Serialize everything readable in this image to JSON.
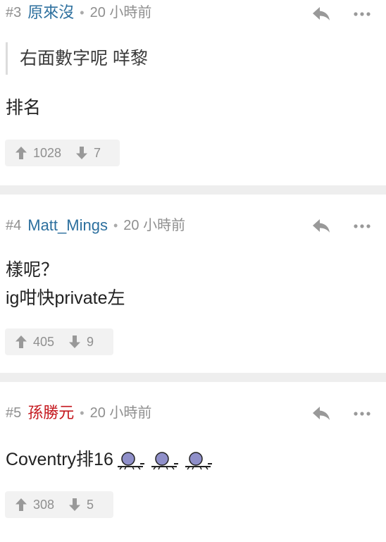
{
  "posts": [
    {
      "number": "#3",
      "username": "原來沒",
      "gender": "male",
      "time": "20 小時前",
      "quote": "右面數字呢 咩黎",
      "body_lines": [
        "排名"
      ],
      "upvotes": "1028",
      "downvotes": "7"
    },
    {
      "number": "#4",
      "username": "Matt_Mings",
      "gender": "male",
      "time": "20 小時前",
      "body_lines": [
        "樣呢？",
        "ig咁快private左"
      ],
      "upvotes": "405",
      "downvotes": "9"
    },
    {
      "number": "#5",
      "username": "孫勝元",
      "gender": "female",
      "time": "20 小時前",
      "body_lines": [
        "Coventry排16"
      ],
      "emoji_count": 3,
      "upvotes": "308",
      "downvotes": "5"
    }
  ],
  "icons": {
    "reply": "reply-icon",
    "more": "more-icon",
    "upvote": "arrow-up-icon",
    "downvote": "arrow-down-icon",
    "emoji": "crawling-creature-emoji-icon"
  },
  "colors": {
    "male_user": "#2c6f9e",
    "female_user": "#c4161c",
    "meta_gray": "#8f8f8f",
    "separator": "#eeeeee",
    "vote_bg": "#f2f2f2"
  }
}
